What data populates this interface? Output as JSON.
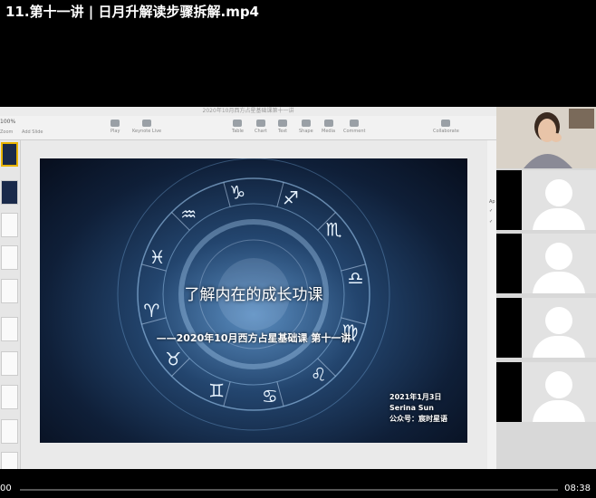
{
  "video": {
    "title": "11.第十一讲 | 日月升解读步骤拆解.mp4",
    "current_time": "00",
    "total_time": "08:38",
    "progress": 0.0
  },
  "keynote": {
    "window_title": "2020年10月西方占星基础课第十一讲",
    "zoom_value": "100%",
    "toolbar": {
      "zoom_label": "Zoom",
      "add_slide_label": "Add Slide",
      "play_label": "Play",
      "keynote_live_label": "Keynote Live",
      "table_label": "Table",
      "chart_label": "Chart",
      "text_label": "Text",
      "shape_label": "Shape",
      "media_label": "Media",
      "comment_label": "Comment",
      "collaborate_label": "Collaborate"
    },
    "slide": {
      "title": "了解内在的成长功课",
      "subtitle": "——2020年10月西方占星基础课 第十一讲",
      "date": "2021年1月3日",
      "author": "Serina Sun",
      "account": "公众号：宸时星语"
    }
  },
  "zodiac_glyphs": [
    "♑",
    "♐",
    "♏",
    "♎",
    "♍",
    "♌",
    "♋",
    "♊",
    "♉",
    "♈",
    "♓",
    "♒"
  ],
  "sidebar_fragments": [
    "Ap",
    "✓",
    "✓"
  ]
}
